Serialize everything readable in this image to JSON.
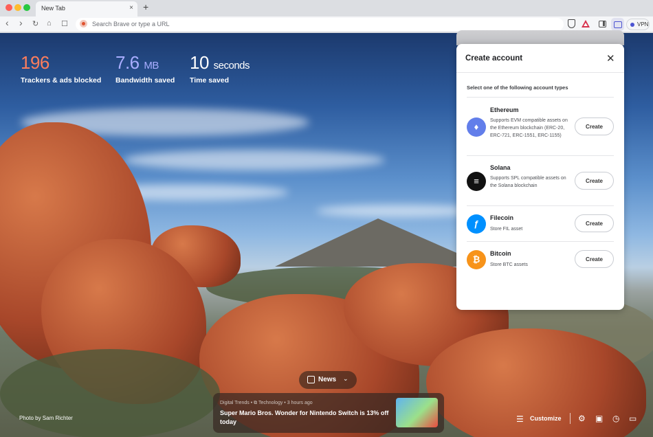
{
  "tabs": [
    {
      "title": "New Tab",
      "close": "×"
    }
  ],
  "new_tab": "+",
  "toolbar": {
    "back": "‹",
    "forward": "›",
    "reload": "↻",
    "home": "⌂",
    "bookmark": "☐",
    "url_placeholder": "Search Brave or type a URL",
    "vpn_label": "VPN"
  },
  "stats": {
    "trackers": {
      "value": "196",
      "label": "Trackers & ads blocked"
    },
    "bandwidth": {
      "value": "7.6",
      "unit": "MB",
      "label": "Bandwidth saved"
    },
    "time": {
      "value": "10",
      "unit": "seconds",
      "label": "Time saved"
    }
  },
  "photo_credit": "Photo by Sam Richter",
  "news": {
    "pill_label": "News",
    "source": "Digital Trends",
    "category": "Technology",
    "time_ago": "3 hours ago",
    "meta": "Digital Trends • ⧉ Technology • 3 hours ago",
    "title": "Super Mario Bros. Wonder for Nintendo Switch is 13% off today"
  },
  "footer": {
    "customize_label": "Customize"
  },
  "wallet_panel": {
    "title": "Create account",
    "close": "✕",
    "subtitle": "Select one of the following account types",
    "accounts": [
      {
        "name": "Ethereum",
        "description": "Supports EVM compatible assets on the Ethereum blockchain (ERC-20, ERC-721, ERC-1551, ERC-1155)",
        "button": "Create",
        "logo": "♦",
        "color": "#627eea"
      },
      {
        "name": "Solana",
        "description": "Supports SPL compatible assets on the Solana blockchain",
        "button": "Create",
        "logo": "≡",
        "color": "#111111"
      },
      {
        "name": "Filecoin",
        "description": "Store FIL asset",
        "button": "Create",
        "logo": "ƒ",
        "color": "#0090ff"
      },
      {
        "name": "Bitcoin",
        "description": "Store BTC assets",
        "button": "Create",
        "logo": "₿",
        "color": "#f7931a"
      }
    ]
  },
  "colors": {
    "trackers_accent": "#ff7e5c",
    "bandwidth_accent": "#a9adff",
    "wallet_accent": "#4c54d2"
  }
}
